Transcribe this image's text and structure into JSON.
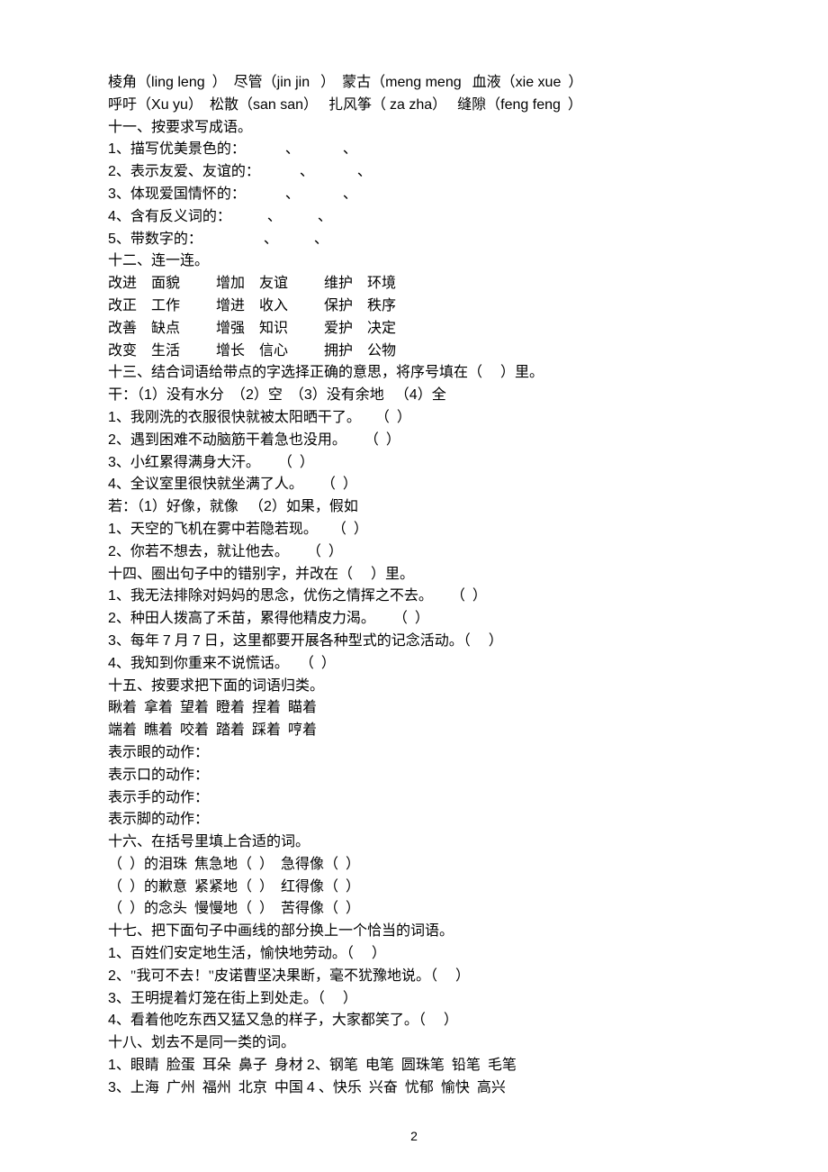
{
  "lines": {
    "l1_a": "棱角（",
    "l1_b": "ling leng",
    "l1_c": "  ）  尽管（",
    "l1_d": "jin jin",
    "l1_e": "   ）  蒙古（",
    "l1_f": "meng meng",
    "l1_g": "   血液（",
    "l1_h": "xie xue",
    "l1_i": "  ）",
    "l2_a": "呼吁（",
    "l2_b": "Xu yu",
    "l2_c": "）  松散（",
    "l2_d": "san san",
    "l2_e": "）   扎风筝（ ",
    "l2_f": "za zha",
    "l2_g": "）   缝隙（",
    "l2_h": "feng feng",
    "l2_i": "  ）",
    "l3": "十一、按要求写成语。",
    "l4_a": "1",
    "l4_b": "、描写优美景色的：           、            、",
    "l5_a": "2",
    "l5_b": "、表示友爱、友谊的：           、            、",
    "l6_a": "3",
    "l6_b": "、体现爱国情怀的：           、            、",
    "l7_a": "4",
    "l7_b": "、含有反义词的：          、          、",
    "l8_a": "5",
    "l8_b": "、带数字的：                 、          、",
    "l9": "十二、连一连。",
    "l10": "改进    面貌          增加    友谊          维护    环境",
    "l11": "改正    工作          增进    收入          保护    秩序",
    "l12": "改善    缺点          增强    知识          爱护    决定",
    "l13": "改变    生活          增长    信心          拥护    公物",
    "l14": "十三、结合词语给带点的字选择正确的意思，将序号填在（     ）里。",
    "l15_a": "干：（",
    "l15_b": "1",
    "l15_c": "）没有水分  （",
    "l15_d": "2",
    "l15_e": "）空  （",
    "l15_f": "3",
    "l15_g": "）没有余地   （",
    "l15_h": "4",
    "l15_i": "）全",
    "l16_a": "1",
    "l16_b": "、我刚洗的衣服很快就被太阳晒干了。    （  ）",
    "l17_a": "2",
    "l17_b": "、遇到困难不动脑筋干着急也没用。     （  ）",
    "l18_a": "3",
    "l18_b": "、小红累得满身大汗。     （  ）",
    "l19_a": "4",
    "l19_b": "、全议室里很快就坐满了人。     （  ）",
    "l20_a": "若：（",
    "l20_b": "1",
    "l20_c": "）好像，就像   （",
    "l20_d": "2",
    "l20_e": "）如果，假如",
    "l21_a": "1",
    "l21_b": "、天空的飞机在雾中若隐若现。    （  ）",
    "l22_a": "2",
    "l22_b": "、你若不想去，就让他去。     （  ）",
    "l23": "十四、圈出句子中的错别字，并改在（     ）里。",
    "l24_a": "1",
    "l24_b": "、我无法排除对妈妈的思念，优伤之情挥之不去。     （  ）",
    "l25_a": "2",
    "l25_b": "、种田人拨高了禾苗，累得他精皮力渴。     （  ）",
    "l26_a": "3",
    "l26_b": "、每年 ",
    "l26_c": "7",
    "l26_d": " 月 ",
    "l26_e": "7",
    "l26_f": " 日，这里都要开展各种型式的记念活动。（     ）",
    "l27_a": "4",
    "l27_b": "、我知到你重来不说慌话。   （  ）",
    "l28": "十五、按要求把下面的词语归类。",
    "l29": "瞅着  拿着  望着  瞪着  捏着  瞄着",
    "l30": "端着  瞧着  咬着  踏着  踩着  哼着",
    "l31": "表示眼的动作：",
    "l32": "表示口的动作：",
    "l33": "表示手的动作：",
    "l34": "表示脚的动作：",
    "l35": "十六、在括号里填上合适的词。",
    "l36": "（  ）的泪珠  焦急地（  ）  急得像（  ）",
    "l37": "（  ）的歉意  紧紧地（  ）  红得像（  ）",
    "l38": "（  ）的念头  慢慢地（  ）  苦得像（  ）",
    "l39": "十七、把下面句子中画线的部分换上一个恰当的词语。",
    "l40_a": "1",
    "l40_b": "、百姓们安定地生活，愉快地劳动。（     ）",
    "l41_a": "2",
    "l41_b": "、\"我可不去！\"皮诺曹坚决果断，毫不犹豫地说。（     ）",
    "l42_a": "3",
    "l42_b": "、王明提着灯笼在街上到处走。（     ）",
    "l43_a": "4",
    "l43_b": "、看着他吃东西又猛又急的样子，大家都笑了。（     ）",
    "l44": "十八、划去不是同一类的词。",
    "l45_a": "1",
    "l45_b": "、眼睛  脸蛋  耳朵  鼻子  身材 ",
    "l45_c": "2",
    "l45_d": "、钢笔  电笔  圆珠笔  铅笔  毛笔",
    "l46_a": "3",
    "l46_b": "、上海  广州  福州  北京  中国 ",
    "l46_c": "4",
    "l46_d": " 、快乐  兴奋  忧郁  愉快  高兴"
  },
  "page_number": "2"
}
